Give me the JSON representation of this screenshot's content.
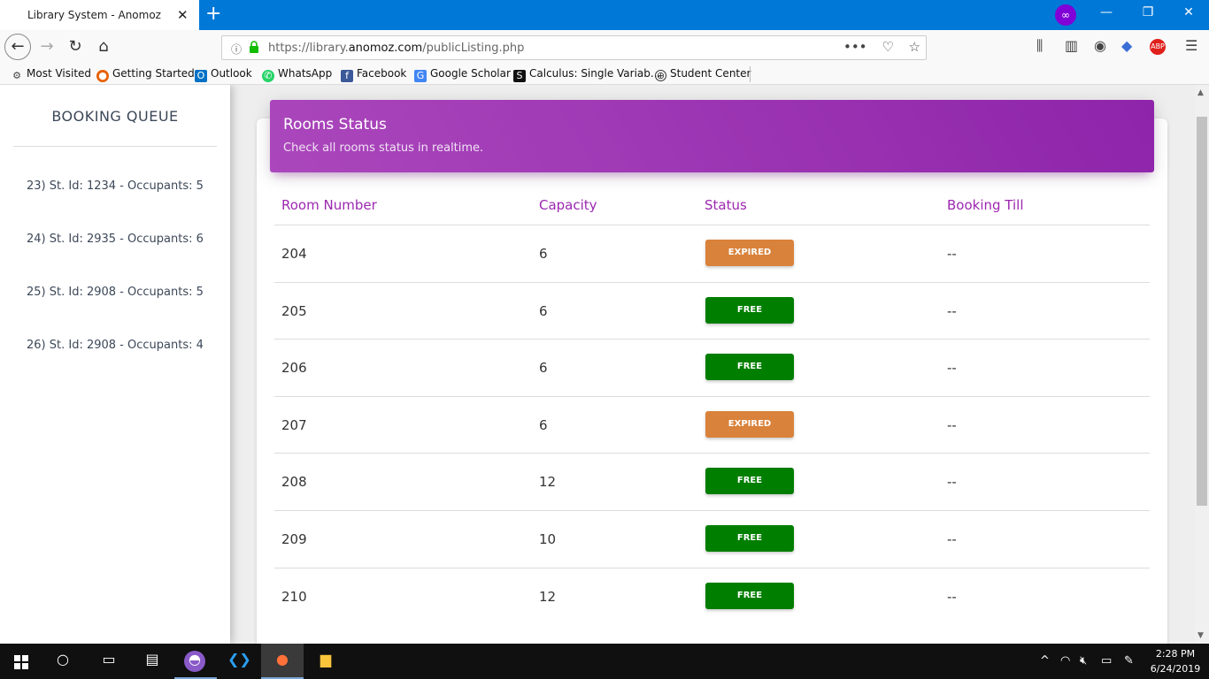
{
  "browser": {
    "tab_title": "Library System - Anomoz",
    "url_prefix": "https://library.",
    "url_domain": "anomoz.com",
    "url_path": "/publicListing.php",
    "bookmarks": [
      "Most Visited",
      "Getting Started",
      "Outlook",
      "WhatsApp",
      "Facebook",
      "Google Scholar",
      "Calculus: Single Variab...",
      "Student Center"
    ]
  },
  "sidebar": {
    "title": "BOOKING QUEUE",
    "items": [
      "23) St. Id: 1234 - Occupants: 5",
      "24) St. Id: 2935 - Occupants: 6",
      "25) St. Id: 2908 - Occupants: 5",
      "26) St. Id: 2908 - Occupants: 4"
    ]
  },
  "card": {
    "title": "Rooms Status",
    "subtitle": "Check all rooms status in realtime."
  },
  "table": {
    "headers": [
      "Room Number",
      "Capacity",
      "Status",
      "Booking Till"
    ],
    "rows": [
      {
        "room": "204",
        "capacity": "6",
        "status": "EXPIRED",
        "till": "--"
      },
      {
        "room": "205",
        "capacity": "6",
        "status": "FREE",
        "till": "--"
      },
      {
        "room": "206",
        "capacity": "6",
        "status": "FREE",
        "till": "--"
      },
      {
        "room": "207",
        "capacity": "6",
        "status": "EXPIRED",
        "till": "--"
      },
      {
        "room": "208",
        "capacity": "12",
        "status": "FREE",
        "till": "--"
      },
      {
        "room": "209",
        "capacity": "10",
        "status": "FREE",
        "till": "--"
      },
      {
        "room": "210",
        "capacity": "12",
        "status": "FREE",
        "till": "--"
      }
    ]
  },
  "colors": {
    "expired": "#d9823b",
    "free": "#007e00",
    "accent": "#9c27b0"
  },
  "taskbar": {
    "time": "2:28 PM",
    "date": "6/24/2019"
  }
}
